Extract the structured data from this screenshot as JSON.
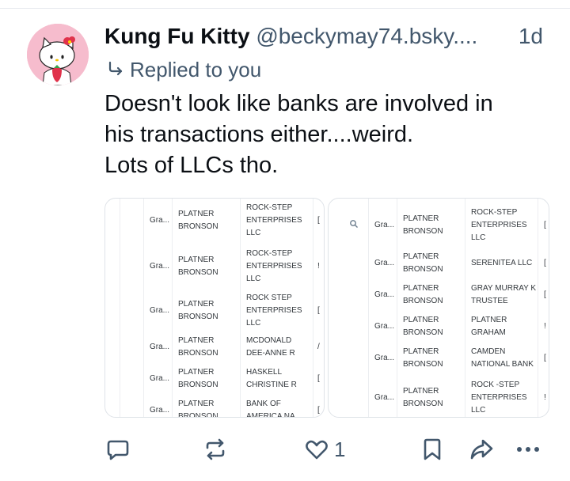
{
  "post": {
    "author_name": "Kung Fu Kitty",
    "author_handle": "@beckymay74.bsky....",
    "timestamp": "1d",
    "reply_context": "Replied to you",
    "text_lines": [
      "Doesn't look like banks are involved in",
      "his transactions either....weird.",
      "Lots of LLCs tho."
    ]
  },
  "images": {
    "left": {
      "rows": [
        {
          "c1": "Gra...",
          "c2a": "PLATNER",
          "c2b": "BRONSON",
          "c3a": "ROCK-STEP",
          "c3b": "ENTERPRISES",
          "c3c": "LLC",
          "c4": "["
        },
        {
          "c1": "Gra...",
          "c2a": "PLATNER",
          "c2b": "BRONSON",
          "c3a": "ROCK-STEP",
          "c3b": "ENTERPRISES",
          "c3c": "LLC",
          "c4": "!"
        },
        {
          "c1": "Gra...",
          "c2a": "PLATNER",
          "c2b": "BRONSON",
          "c3a": "ROCK STEP",
          "c3b": "ENTERPRISES",
          "c3c": "LLC",
          "c4": "["
        },
        {
          "c1": "Gra...",
          "c2a": "PLATNER",
          "c2b": "BRONSON",
          "c3a": "MCDONALD",
          "c3b": "DEE-ANNE R",
          "c3c": "",
          "c4": "/"
        },
        {
          "c1": "Gra...",
          "c2a": "PLATNER",
          "c2b": "BRONSON",
          "c3a": "HASKELL",
          "c3b": "CHRISTINE R",
          "c3c": "",
          "c4": "["
        },
        {
          "c1": "Gra...",
          "c2a": "PLATNER",
          "c2b": "BRONSON",
          "c3a": "BANK OF",
          "c3b": "AMERICA NA",
          "c3c": "",
          "c4": "["
        }
      ]
    },
    "right": {
      "rows": [
        {
          "c1": "Gra...",
          "c2a": "PLATNER",
          "c2b": "BRONSON",
          "c3a": "ROCK-STEP",
          "c3b": "ENTERPRISES",
          "c3c": "LLC",
          "c4": "["
        },
        {
          "c1": "Gra...",
          "c2a": "PLATNER",
          "c2b": "BRONSON",
          "c3a": "SERENITEA LLC",
          "c3b": "",
          "c3c": "",
          "c4": "["
        },
        {
          "c1": "Gra...",
          "c2a": "PLATNER",
          "c2b": "BRONSON",
          "c3a": "GRAY MURRAY K",
          "c3b": "TRUSTEE",
          "c3c": "",
          "c4": "["
        },
        {
          "c1": "Gra...",
          "c2a": "PLATNER",
          "c2b": "BRONSON",
          "c3a": "PLATNER",
          "c3b": "GRAHAM",
          "c3c": "",
          "c4": "!"
        },
        {
          "c1": "Gra...",
          "c2a": "PLATNER",
          "c2b": "BRONSON",
          "c3a": "CAMDEN",
          "c3b": "NATIONAL BANK",
          "c3c": "",
          "c4": "["
        },
        {
          "c1": "Gra...",
          "c2a": "PLATNER",
          "c2b": "BRONSON",
          "c3a": "ROCK -STEP",
          "c3b": "ENTERPRISES",
          "c3c": "LLC",
          "c4": "!"
        }
      ]
    }
  },
  "actions": {
    "reply_icon": "speech-bubble-icon",
    "repost_icon": "repost-icon",
    "like_icon": "heart-icon",
    "like_count": "1",
    "bookmark_icon": "bookmark-icon",
    "share_icon": "share-arrow-icon",
    "more_icon": "ellipsis-icon"
  },
  "colors": {
    "secondary_text": "#42576c",
    "avatar_bg": "#f6bccd"
  }
}
